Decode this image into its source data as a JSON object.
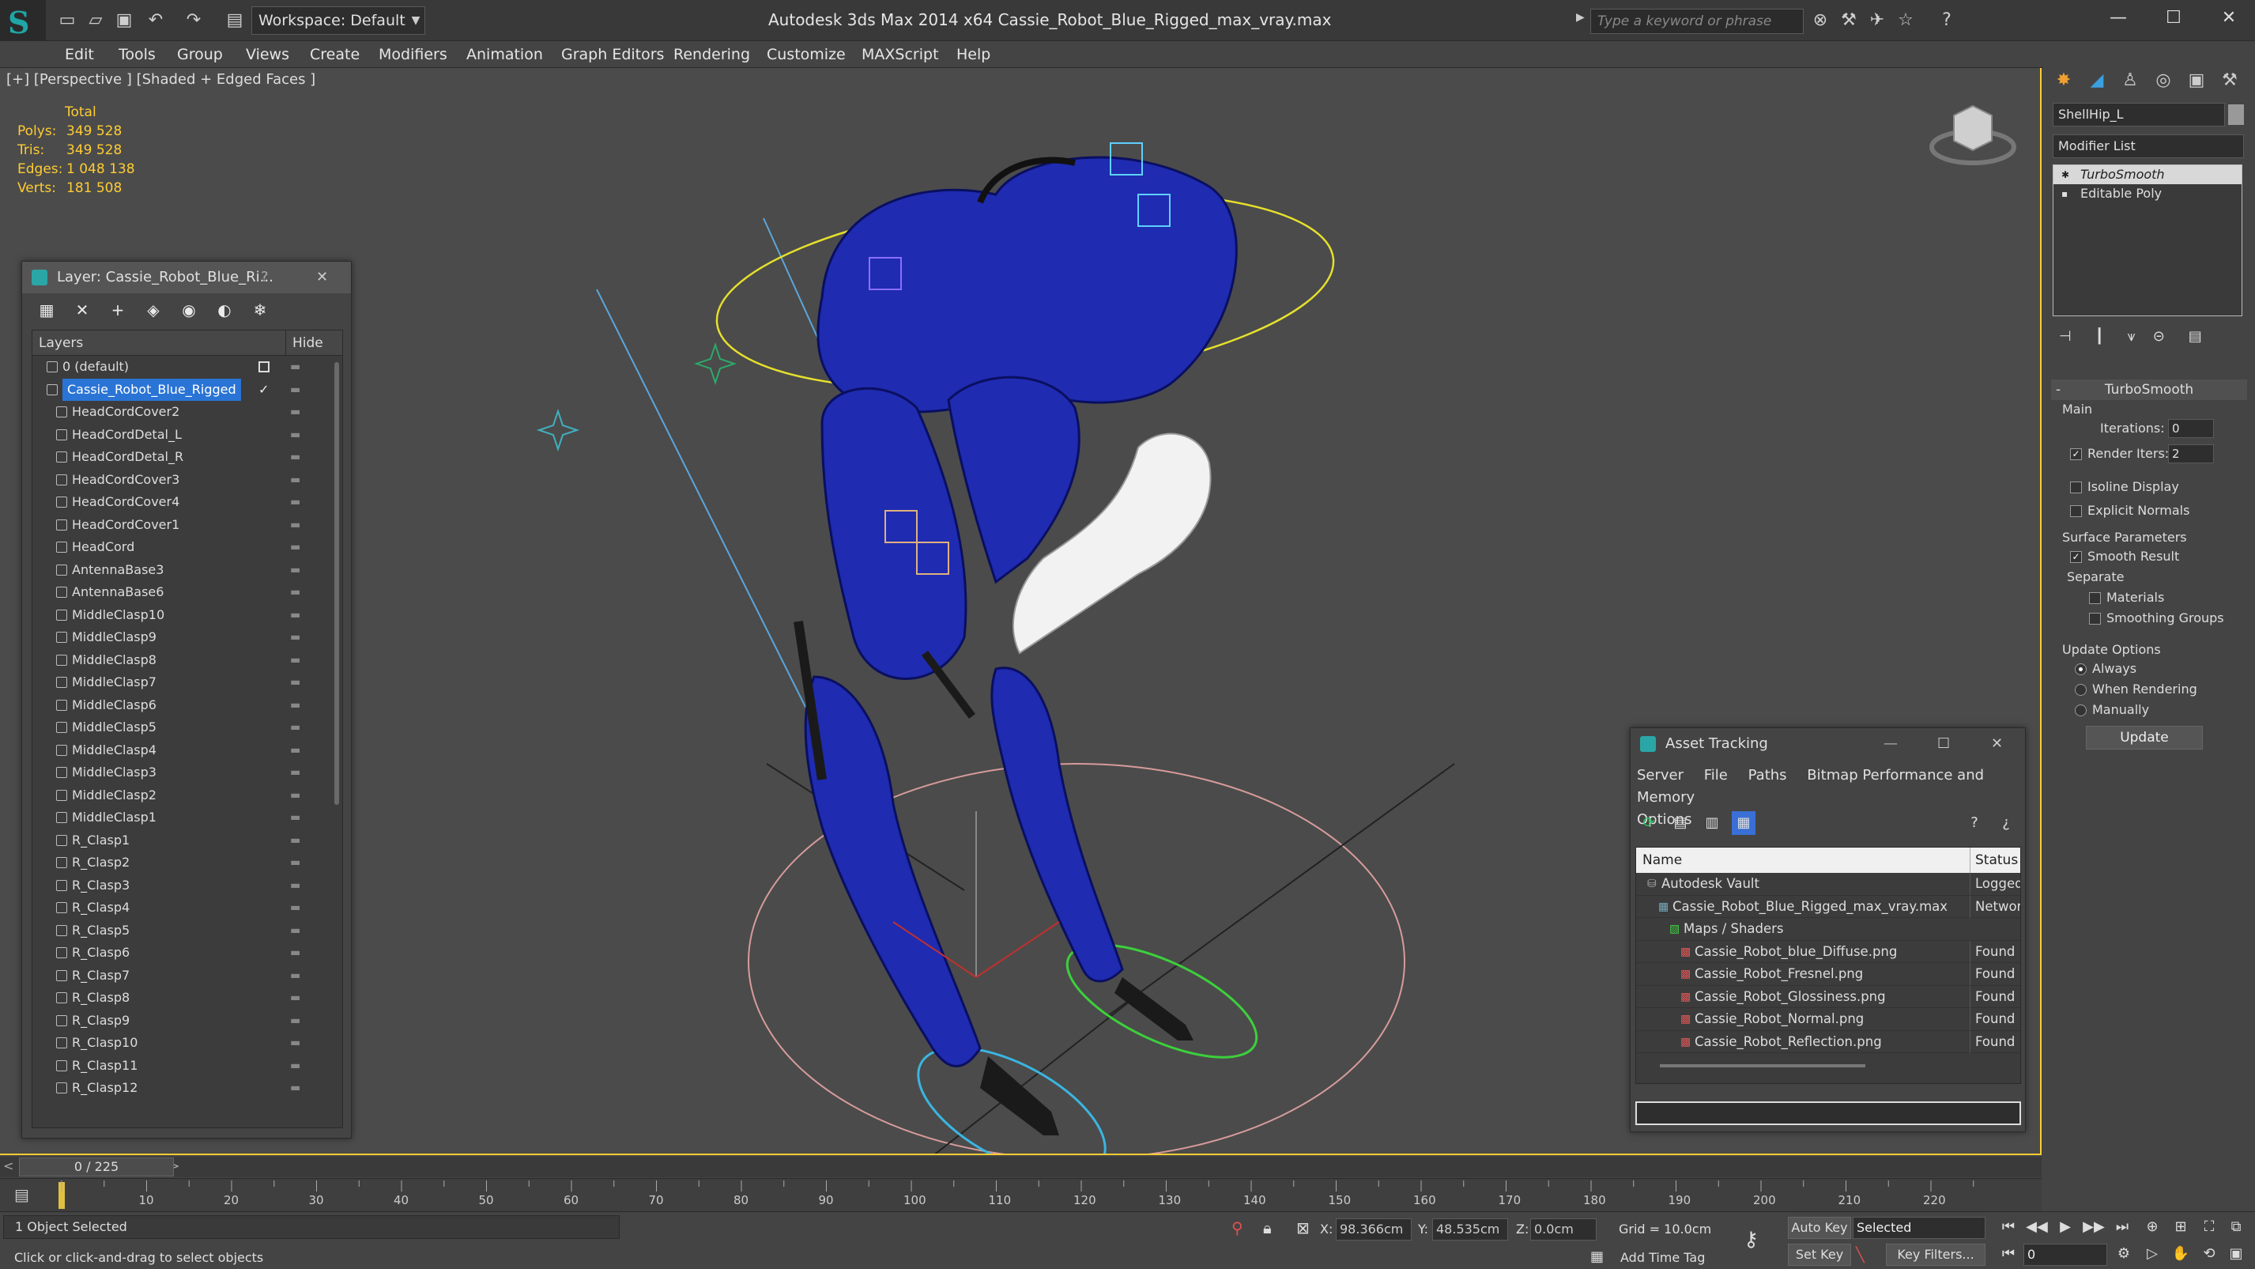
{
  "titlebar": {
    "workspace": "Workspace: Default",
    "title": "Autodesk 3ds Max  2014 x64      Cassie_Robot_Blue_Rigged_max_vray.max",
    "search_placeholder": "Type a keyword or phrase"
  },
  "menu": [
    "Edit",
    "Tools",
    "Group",
    "Views",
    "Create",
    "Modifiers",
    "Animation",
    "Graph Editors",
    "Rendering",
    "Customize",
    "MAXScript",
    "Help"
  ],
  "viewport": {
    "label": "[+] [Perspective ] [Shaded + Edged Faces ]",
    "stats": {
      "total_label": "Total",
      "rows": [
        {
          "label": "Polys:",
          "value": "349 528"
        },
        {
          "label": "Tris:",
          "value": "349 528"
        },
        {
          "label": "Edges:",
          "value": "1 048 138"
        },
        {
          "label": "Verts:",
          "value": "181 508"
        }
      ]
    },
    "colors": {
      "background": "#4b4b4b",
      "robot_blue": "#2230b8",
      "stats_yellow": "#ffcc33",
      "active_border": "#ffcc33"
    }
  },
  "layer_panel": {
    "title": "Layer: Cassie_Robot_Blue_Ri...",
    "help": "?",
    "close": "✕",
    "header_layers": "Layers",
    "header_hide": "Hide",
    "layers": [
      {
        "name": "0 (default)",
        "level": 0
      },
      {
        "name": "Cassie_Robot_Blue_Rigged",
        "level": 0,
        "selected": true
      },
      {
        "name": "HeadCordCover2",
        "level": 1
      },
      {
        "name": "HeadCordDetal_L",
        "level": 1
      },
      {
        "name": "HeadCordDetal_R",
        "level": 1
      },
      {
        "name": "HeadCordCover3",
        "level": 1
      },
      {
        "name": "HeadCordCover4",
        "level": 1
      },
      {
        "name": "HeadCordCover1",
        "level": 1
      },
      {
        "name": "HeadCord",
        "level": 1
      },
      {
        "name": "AntennaBase3",
        "level": 1
      },
      {
        "name": "AntennaBase6",
        "level": 1
      },
      {
        "name": "MiddleClasp10",
        "level": 1
      },
      {
        "name": "MiddleClasp9",
        "level": 1
      },
      {
        "name": "MiddleClasp8",
        "level": 1
      },
      {
        "name": "MiddleClasp7",
        "level": 1
      },
      {
        "name": "MiddleClasp6",
        "level": 1
      },
      {
        "name": "MiddleClasp5",
        "level": 1
      },
      {
        "name": "MiddleClasp4",
        "level": 1
      },
      {
        "name": "MiddleClasp3",
        "level": 1
      },
      {
        "name": "MiddleClasp2",
        "level": 1
      },
      {
        "name": "MiddleClasp1",
        "level": 1
      },
      {
        "name": "R_Clasp1",
        "level": 1
      },
      {
        "name": "R_Clasp2",
        "level": 1
      },
      {
        "name": "R_Clasp3",
        "level": 1
      },
      {
        "name": "R_Clasp4",
        "level": 1
      },
      {
        "name": "R_Clasp5",
        "level": 1
      },
      {
        "name": "R_Clasp6",
        "level": 1
      },
      {
        "name": "R_Clasp7",
        "level": 1
      },
      {
        "name": "R_Clasp8",
        "level": 1
      },
      {
        "name": "R_Clasp9",
        "level": 1
      },
      {
        "name": "R_Clasp10",
        "level": 1
      },
      {
        "name": "R_Clasp11",
        "level": 1
      },
      {
        "name": "R_Clasp12",
        "level": 1
      }
    ]
  },
  "asset_panel": {
    "title": "Asset Tracking",
    "menu_row1": [
      "Server",
      "File",
      "Paths",
      "Bitmap Performance and Memory"
    ],
    "menu_row2": [
      "Options"
    ],
    "col_name": "Name",
    "col_status": "Status",
    "rows": [
      {
        "name": "Autodesk Vault",
        "status": "Logged",
        "indent": 0
      },
      {
        "name": "Cassie_Robot_Blue_Rigged_max_vray.max",
        "status": "Networ",
        "indent": 1
      },
      {
        "name": "Maps / Shaders",
        "status": "",
        "indent": 2
      },
      {
        "name": "Cassie_Robot_blue_Diffuse.png",
        "status": "Found",
        "indent": 3
      },
      {
        "name": "Cassie_Robot_Fresnel.png",
        "status": "Found",
        "indent": 3
      },
      {
        "name": "Cassie_Robot_Glossiness.png",
        "status": "Found",
        "indent": 3
      },
      {
        "name": "Cassie_Robot_Normal.png",
        "status": "Found",
        "indent": 3
      },
      {
        "name": "Cassie_Robot_Reflection.png",
        "status": "Found",
        "indent": 3
      }
    ]
  },
  "command_panel": {
    "object_name": "ShellHip_L",
    "modifier_list": "Modifier List",
    "stack": [
      "TurboSmooth",
      "Editable Poly"
    ],
    "turbosmooth": {
      "title": "TurboSmooth",
      "main_label": "Main",
      "iterations_label": "Iterations:",
      "iterations_value": "0",
      "render_iters_label": "Render Iters:",
      "render_iters_value": "2",
      "isoline_label": "Isoline Display",
      "explicit_label": "Explicit Normals",
      "surface_label": "Surface Parameters",
      "smooth_label": "Smooth Result",
      "separate_label": "Separate",
      "materials_label": "Materials",
      "smoothing_label": "Smoothing Groups",
      "update_label": "Update Options",
      "always_label": "Always",
      "when_rendering_label": "When Rendering",
      "manually_label": "Manually",
      "update_button": "Update"
    }
  },
  "timeline": {
    "position": "0 / 225",
    "ticks": [
      "10",
      "20",
      "30",
      "40",
      "50",
      "60",
      "70",
      "80",
      "90",
      "100",
      "110",
      "120",
      "130",
      "140",
      "150",
      "160",
      "170",
      "180",
      "190",
      "200",
      "210",
      "220"
    ]
  },
  "statusbar": {
    "selection": "1 Object Selected",
    "prompt": "Click or click-and-drag to select objects",
    "x_label": "X:",
    "x_value": "98.366cm",
    "y_label": "Y:",
    "y_value": "48.535cm",
    "z_label": "Z:",
    "z_value": "0.0cm",
    "grid": "Grid = 10.0cm",
    "add_time_tag": "Add Time Tag",
    "auto_key": "Auto Key",
    "set_key": "Set Key",
    "selected": "Selected",
    "key_filters": "Key Filters...",
    "frame": "0"
  }
}
